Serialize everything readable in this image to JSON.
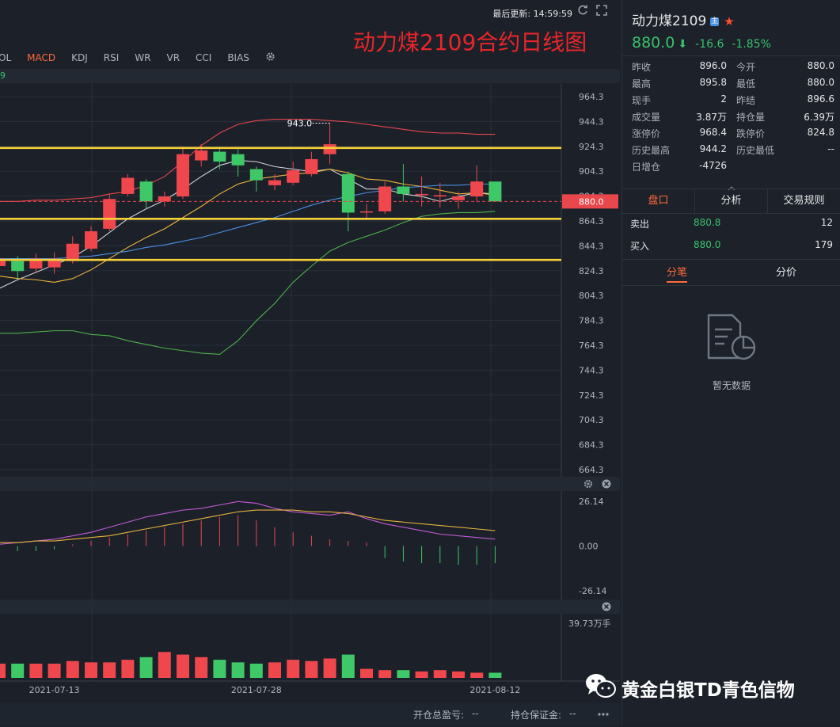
{
  "header": {
    "last_update": "最后更新: 14:59:59",
    "title": "动力煤2109合约日线图",
    "refresh_icon": "refresh-icon",
    "fullscreen_icon": "fullscreen-icon"
  },
  "indicator_tabs": [
    {
      "label": "VOL",
      "active": false
    },
    {
      "label": "MACD",
      "active": true
    },
    {
      "label": "KDJ",
      "active": false
    },
    {
      "label": "RSI",
      "active": false
    },
    {
      "label": "WR",
      "active": false
    },
    {
      "label": "VR",
      "active": false
    },
    {
      "label": "CCI",
      "active": false
    },
    {
      "label": "BIAS",
      "active": false
    }
  ],
  "sub_strip_text": "9",
  "colors": {
    "up": "#f0474d",
    "down": "#3fc867",
    "bg": "#1b2029",
    "grid": "#2a303a",
    "yellow": "#f5d13a",
    "accent": "#ff6a3d"
  },
  "chart_data": {
    "type": "candlestick",
    "price_axis": {
      "ticks": [
        "964.3",
        "944.3",
        "924.3",
        "904.3",
        "884.3",
        "864.3",
        "844.3",
        "824.3",
        "804.3",
        "784.3",
        "764.3",
        "744.3",
        "724.3",
        "704.3",
        "684.3",
        "664.3"
      ],
      "ylim": [
        664.3,
        964.3
      ]
    },
    "current_price": {
      "value": 880.0,
      "label": "880.0"
    },
    "high_label": {
      "value": 943.0,
      "label": "943.0"
    },
    "horizontal_levels": [
      923.0,
      866.0,
      833.0
    ],
    "candles": [
      {
        "o": 828,
        "c": 834,
        "h": 840,
        "l": 822
      },
      {
        "o": 832,
        "c": 824,
        "h": 836,
        "l": 818
      },
      {
        "o": 826,
        "c": 834,
        "h": 838,
        "l": 822
      },
      {
        "o": 827,
        "c": 834,
        "h": 839,
        "l": 822
      },
      {
        "o": 832,
        "c": 846,
        "h": 852,
        "l": 830
      },
      {
        "o": 842,
        "c": 856,
        "h": 860,
        "l": 840
      },
      {
        "o": 858,
        "c": 882,
        "h": 886,
        "l": 856
      },
      {
        "o": 886,
        "c": 899,
        "h": 902,
        "l": 884
      },
      {
        "o": 896,
        "c": 880,
        "h": 898,
        "l": 874
      },
      {
        "o": 880,
        "c": 884,
        "h": 888,
        "l": 876
      },
      {
        "o": 884,
        "c": 918,
        "h": 924,
        "l": 882
      },
      {
        "o": 913,
        "c": 921,
        "h": 926,
        "l": 908
      },
      {
        "o": 920,
        "c": 912,
        "h": 924,
        "l": 906
      },
      {
        "o": 918,
        "c": 909,
        "h": 922,
        "l": 900
      },
      {
        "o": 906,
        "c": 897,
        "h": 908,
        "l": 888
      },
      {
        "o": 893,
        "c": 897,
        "h": 902,
        "l": 889
      },
      {
        "o": 895,
        "c": 905,
        "h": 912,
        "l": 893
      },
      {
        "o": 902,
        "c": 914,
        "h": 920,
        "l": 900
      },
      {
        "o": 918,
        "c": 926,
        "h": 943,
        "l": 910
      },
      {
        "o": 902,
        "c": 871,
        "h": 904,
        "l": 856
      },
      {
        "o": 872,
        "c": 872,
        "h": 878,
        "l": 866
      },
      {
        "o": 872,
        "c": 892,
        "h": 896,
        "l": 870
      },
      {
        "o": 892,
        "c": 886,
        "h": 910,
        "l": 880
      },
      {
        "o": 885,
        "c": 886,
        "h": 900,
        "l": 876
      },
      {
        "o": 884,
        "c": 885,
        "h": 895,
        "l": 875
      },
      {
        "o": 881,
        "c": 884,
        "h": 888,
        "l": 874
      },
      {
        "o": 884,
        "c": 896,
        "h": 909,
        "l": 880
      },
      {
        "o": 896,
        "c": 880,
        "h": 896,
        "l": 880
      }
    ],
    "ma_lines": [
      {
        "color": "#cfd3d8",
        "values": [
          810,
          817,
          823,
          829,
          835,
          844,
          855,
          866,
          874,
          881,
          890,
          900,
          909,
          913,
          912,
          908,
          906,
          904,
          906,
          898,
          890,
          890,
          886,
          884,
          880,
          884,
          887,
          886
        ]
      },
      {
        "color": "#f0b43c",
        "values": [
          820,
          818,
          817,
          815,
          818,
          825,
          834,
          843,
          851,
          858,
          867,
          876,
          886,
          894,
          898,
          900,
          902,
          903,
          906,
          903,
          898,
          897,
          894,
          892,
          889,
          886,
          887,
          885
        ]
      },
      {
        "color": "#4a8fe2",
        "values": [
          834,
          834,
          834,
          834,
          835,
          836,
          838,
          840,
          843,
          845,
          848,
          851,
          855,
          859,
          863,
          867,
          872,
          877,
          881,
          884,
          887,
          889,
          891,
          892,
          893,
          893,
          894,
          894
        ]
      },
      {
        "color": "#e8474b",
        "values": [
          880,
          880,
          881,
          881,
          882,
          883,
          886,
          888,
          893,
          900,
          912,
          925,
          935,
          942,
          945,
          946,
          946,
          946,
          945,
          944,
          942,
          940,
          938,
          936,
          935,
          935,
          934,
          934
        ]
      },
      {
        "color": "#4fb04a",
        "values": [
          774,
          774,
          775,
          776,
          776,
          773,
          772,
          768,
          765,
          762,
          760,
          758,
          757,
          768,
          784,
          798,
          815,
          828,
          840,
          847,
          852,
          857,
          863,
          868,
          870,
          871,
          871,
          872
        ]
      }
    ],
    "macd": {
      "axis_ticks": [
        "26.14",
        "0.00",
        "-26.14"
      ],
      "ylim": [
        -26.14,
        26.14
      ],
      "hist": [
        -2,
        -3,
        -3,
        -2,
        1,
        3,
        5,
        7,
        9,
        11,
        13,
        15,
        17,
        18,
        15,
        11,
        8,
        6,
        4,
        3,
        2,
        -7,
        -9,
        -10,
        -10,
        -11,
        -11,
        -10
      ],
      "dif": [
        1,
        2,
        3,
        4,
        6,
        8,
        11,
        14,
        17,
        19,
        21,
        22,
        24,
        26,
        25,
        22,
        20,
        19,
        18,
        20,
        16,
        13,
        11,
        9,
        7,
        6,
        5,
        4
      ],
      "dea": [
        2,
        2,
        3,
        3,
        4,
        5,
        6,
        8,
        10,
        12,
        14,
        16,
        18,
        20,
        21,
        21,
        21,
        20,
        20,
        19,
        17,
        15,
        14,
        13,
        12,
        11,
        10,
        9
      ]
    },
    "volume": {
      "axis_max_label": "39.73万手",
      "values": [
        11,
        11,
        11,
        11,
        13,
        12,
        12,
        14,
        16,
        20,
        18,
        16,
        14,
        12,
        11,
        12,
        14,
        13,
        15,
        18,
        7,
        6,
        6,
        5,
        6,
        5,
        4,
        4
      ]
    },
    "x_ticks": [
      {
        "index": 3,
        "label": "2021-07-13"
      },
      {
        "index": 14,
        "label": "2021-07-28"
      },
      {
        "index": 27,
        "label": "2021-08-12"
      }
    ],
    "macd_controls": [
      "gear-icon",
      "close-icon"
    ],
    "volume_controls": [
      "close-icon"
    ]
  },
  "bottom_status": {
    "pnl_label": "开仓总盈亏:",
    "pnl_value": "--",
    "margin_label": "持仓保证金:",
    "margin_value": "--"
  },
  "watermark": "黄金白银TD青色信物",
  "panel": {
    "symbol": "动力煤2109",
    "badge": "主",
    "price": "880.0",
    "change": "-16.6",
    "change_pct": "-1.85%",
    "stats": [
      {
        "l": "昨收",
        "v": "896.0",
        "l2": "今开",
        "v2": "880.0"
      },
      {
        "l": "最高",
        "v": "895.8",
        "l2": "最低",
        "v2": "880.0"
      },
      {
        "l": "现手",
        "v": "2",
        "l2": "昨结",
        "v2": "896.6"
      },
      {
        "l": "成交量",
        "v": "3.87万",
        "l2": "持仓量",
        "v2": "6.39万"
      },
      {
        "l": "涨停价",
        "v": "968.4",
        "l2": "跌停价",
        "v2": "824.8"
      },
      {
        "l": "历史最高",
        "v": "944.2",
        "l2": "历史最低",
        "v2": "--"
      },
      {
        "l": "日增仓",
        "v": "-4726",
        "l2": "",
        "v2": ""
      }
    ],
    "tabs": [
      {
        "label": "盘口",
        "active": true
      },
      {
        "label": "分析",
        "active": false
      },
      {
        "label": "交易规则",
        "active": false
      }
    ],
    "book": [
      {
        "name": "卖出",
        "price": "880.8",
        "qty": "12"
      },
      {
        "name": "买入",
        "price": "880.0",
        "qty": "179"
      }
    ],
    "subtabs": [
      {
        "label": "分笔",
        "active": true
      },
      {
        "label": "分价",
        "active": false
      }
    ],
    "no_data": "暂无数据"
  }
}
